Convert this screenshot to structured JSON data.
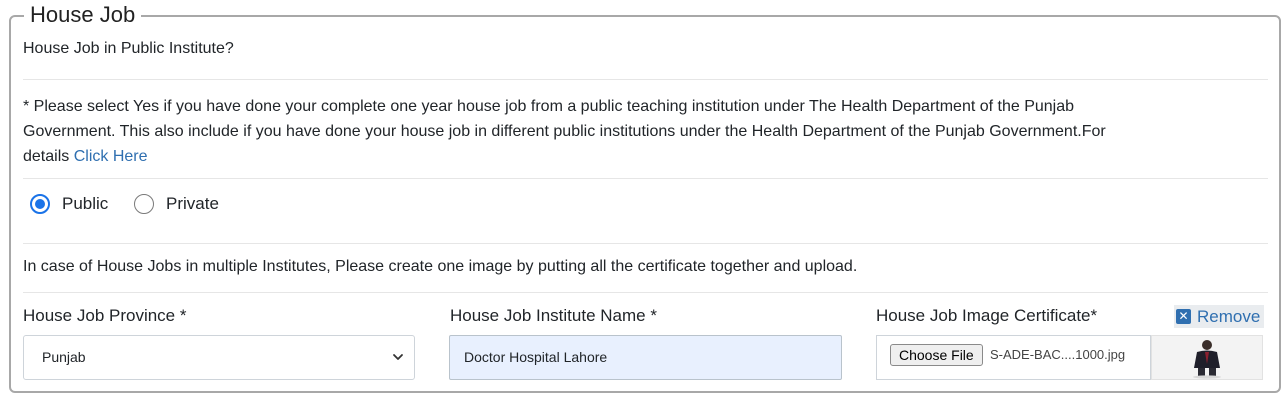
{
  "section": {
    "legend": "House Job"
  },
  "question": "House Job in Public Institute?",
  "note": {
    "line1": "* Please select Yes if you have done your complete one year house job from a public teaching institution under The Health Department of the Punjab",
    "line2": "Government. This also include if you have done your house job in different public institutions under the Health Department of the Punjab Government.For",
    "line3_prefix": "details ",
    "link_text": "Click Here"
  },
  "radios": [
    {
      "label": "Public",
      "checked": true
    },
    {
      "label": "Private",
      "checked": false
    }
  ],
  "instruction": "In case of House Jobs in multiple Institutes, Please create one image by putting all the certificate together and upload.",
  "fields": {
    "province": {
      "label": "House Job Province *",
      "value": "Punjab"
    },
    "institute": {
      "label": "House Job Institute Name *",
      "value": "Doctor Hospital Lahore"
    },
    "certificate": {
      "label": "House Job Image Certificate*",
      "button": "Choose File",
      "filename": "S-ADE-BAC....1000.jpg",
      "remove": "Remove"
    }
  },
  "colors": {
    "accent": "#1a73e8",
    "link": "#2f6fb0",
    "autofill": "#e8f0fe"
  }
}
